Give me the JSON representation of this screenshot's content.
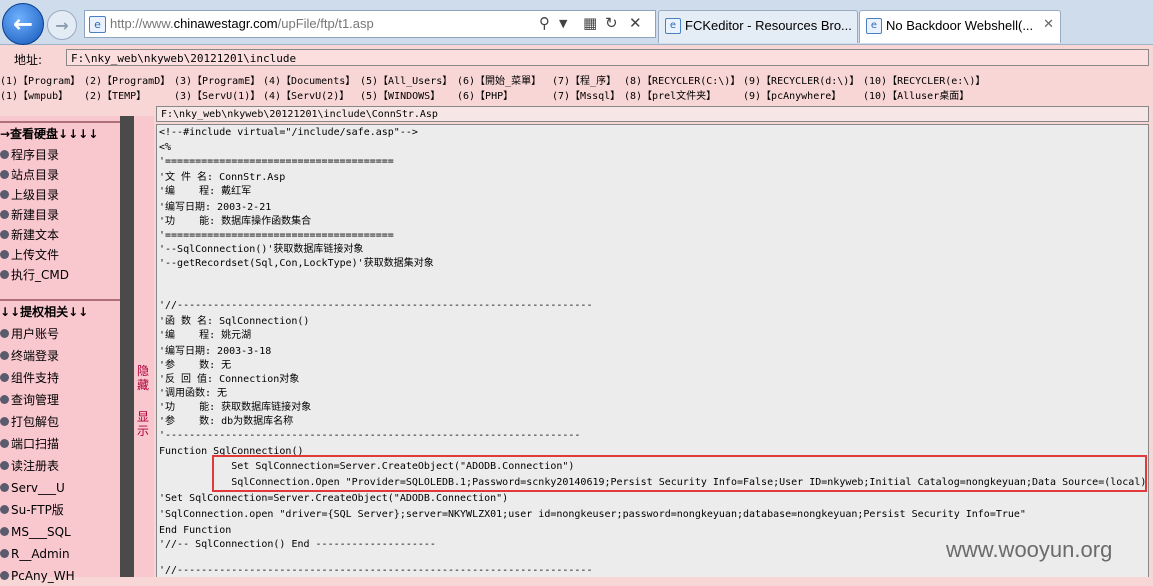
{
  "browser": {
    "url_prefix": "http://www.",
    "url_domain": "chinawestagr.com",
    "url_path": "/upFile/ftp/t1.asp",
    "tabs": [
      {
        "label": "FCKeditor - Resources Bro...",
        "active": false
      },
      {
        "label": "No Backdoor Webshell(...",
        "active": true
      }
    ]
  },
  "shell": {
    "address_label": "地址:",
    "current_path": "F:\\nky_web\\nkyweb\\20121201\\include",
    "quick_links_row1": [
      "(1)【Program】",
      "(2)【ProgramD】",
      "(3)【ProgramE】",
      "(4)【Documents】",
      "(5)【All_Users】",
      "(6)【開始_菜單】",
      "(7)【程_序】",
      "(8)【RECYCLER(C:\\)】",
      "(9)【RECYCLER(d:\\)】",
      "(10)【RECYCLER(e:\\)】"
    ],
    "quick_links_row2": [
      "(1)【wmpub】",
      "(2)【TEMP】",
      "(3)【ServU(1)】",
      "(4)【ServU(2)】",
      "(5)【WINDOWS】",
      "(6)【PHP】",
      "(7)【Mssql】",
      "(8)【prel文件夹】",
      "(9)【pcAnywhere】",
      "(10)【Alluser桌面】"
    ],
    "file_path": "F:\\nky_web\\nkyweb\\20121201\\include\\ConnStr.Asp",
    "menu_head_1": "→查看硬盘↓↓↓↓",
    "menu_items_1": [
      "程序目录",
      "站点目录",
      "上级目录",
      "新建目录",
      "新建文本",
      "上传文件",
      "执行_CMD"
    ],
    "menu_head_2": "↓↓提权相关↓↓",
    "menu_items_2": [
      "用户账号",
      "终端登录",
      "组件支持",
      "查询管理",
      "打包解包",
      "端口扫描",
      "读注册表",
      "Serv___U",
      "Su-FTP版",
      "MS___SQL",
      "R__Admin",
      "PcAny_WH"
    ],
    "toggle_hide": "隐藏",
    "toggle_show": "显示",
    "code_lines": [
      "<!--#include virtual=\"/include/safe.asp\"-->",
      "<%",
      "'======================================",
      "'文 件 名: ConnStr.Asp",
      "'编    程: 戴红军",
      "'编写日期: 2003-2-21",
      "'功    能: 数据库操作函数集合",
      "'======================================",
      "'--SqlConnection()'获取数据库链接对象",
      "'--getRecordset(Sql,Con,LockType)'获取数据集对象",
      "",
      "",
      "'//---------------------------------------------------------------------",
      "'函 数 名: SqlConnection()",
      "'编    程: 姚元湖",
      "'编写日期: 2003-3-18",
      "'参    数: 无",
      "'反 回 值: Connection对象",
      "'调用函数: 无",
      "'功    能: 获取数据库链接对象",
      "'参    数: db为数据库名称",
      "'---------------------------------------------------------------------",
      "Function SqlConnection()",
      "            Set SqlConnection=Server.CreateObject(\"ADODB.Connection\")",
      "            SqlConnection.Open \"Provider=SQLOLEDB.1;Password=scnky20140619;Persist Security Info=False;User ID=nkyweb;Initial Catalog=nongkeyuan;Data Source=(local)\"",
      "'Set SqlConnection=Server.CreateObject(\"ADODB.Connection\")",
      "'SqlConnection.open \"driver={SQL Server};server=NKYWLZX01;user id=nongkeuser;password=nongkeyuan;database=nongkeyuan;Persist Security Info=True\"",
      "End Function",
      "'//-- SqlConnection() End --------------------",
      "",
      "'//---------------------------------------------------------------------"
    ]
  },
  "watermark": "www.wooyun.org"
}
